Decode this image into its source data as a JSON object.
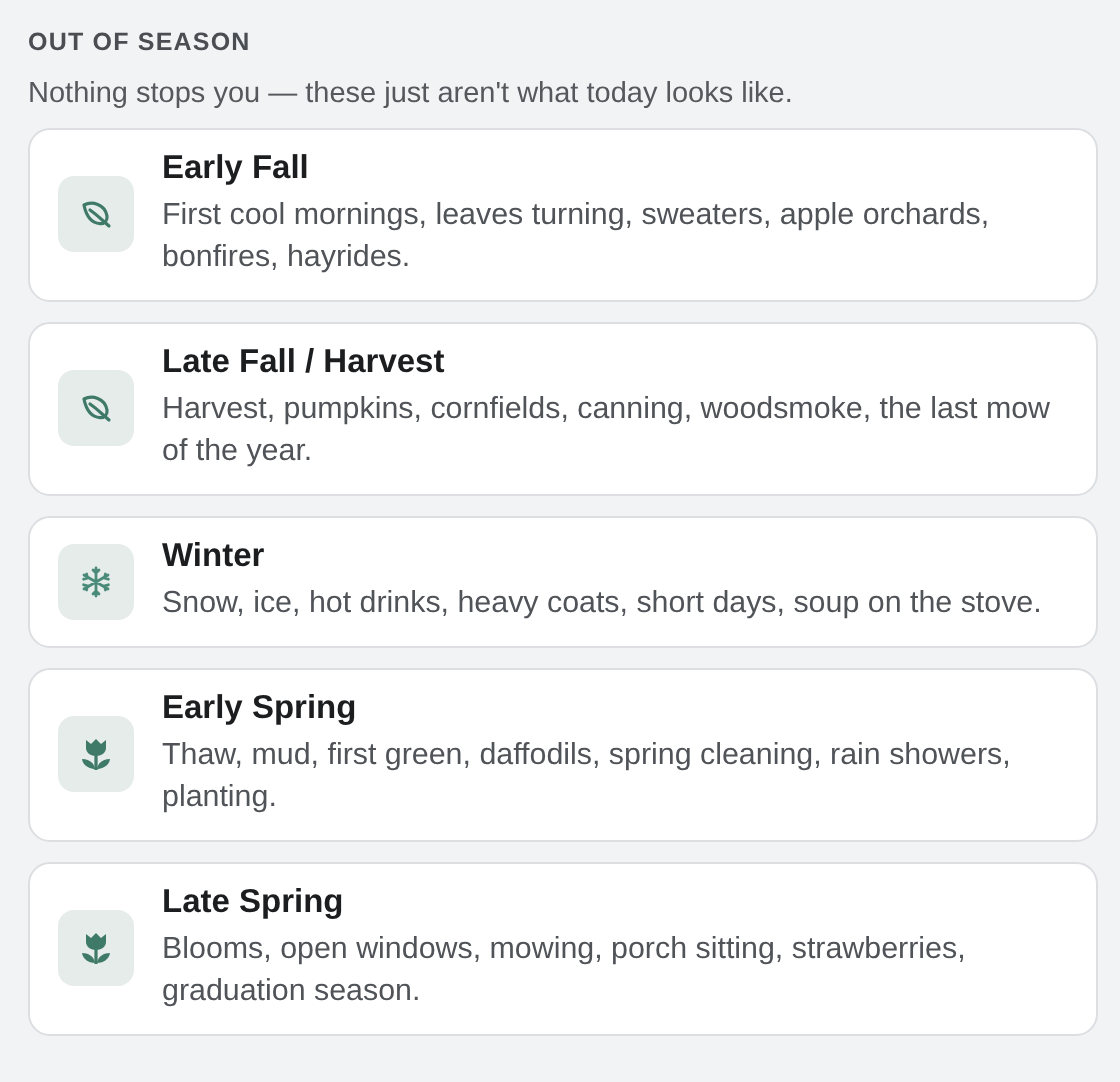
{
  "heading": "OUT OF SEASON",
  "subtitle": "Nothing stops you — these just aren't what today looks like.",
  "seasons": [
    {
      "kind": "leaf",
      "title": "Early Fall",
      "description": "First cool mornings, leaves turning, sweaters, apple orchards, bonfires, hayrides."
    },
    {
      "kind": "leaf",
      "title": "Late Fall / Harvest",
      "description": "Harvest, pumpkins, cornfields, canning, woodsmoke, the last mow of the year."
    },
    {
      "kind": "snowflake",
      "title": "Winter",
      "description": "Snow, ice, hot drinks, heavy coats, short days, soup on the stove."
    },
    {
      "kind": "tulip",
      "title": "Early Spring",
      "description": "Thaw, mud, first green, daffodils, spring cleaning, rain showers, planting."
    },
    {
      "kind": "tulip",
      "title": "Late Spring",
      "description": "Blooms, open windows, mowing, porch sitting, strawberries, graduation season."
    }
  ]
}
